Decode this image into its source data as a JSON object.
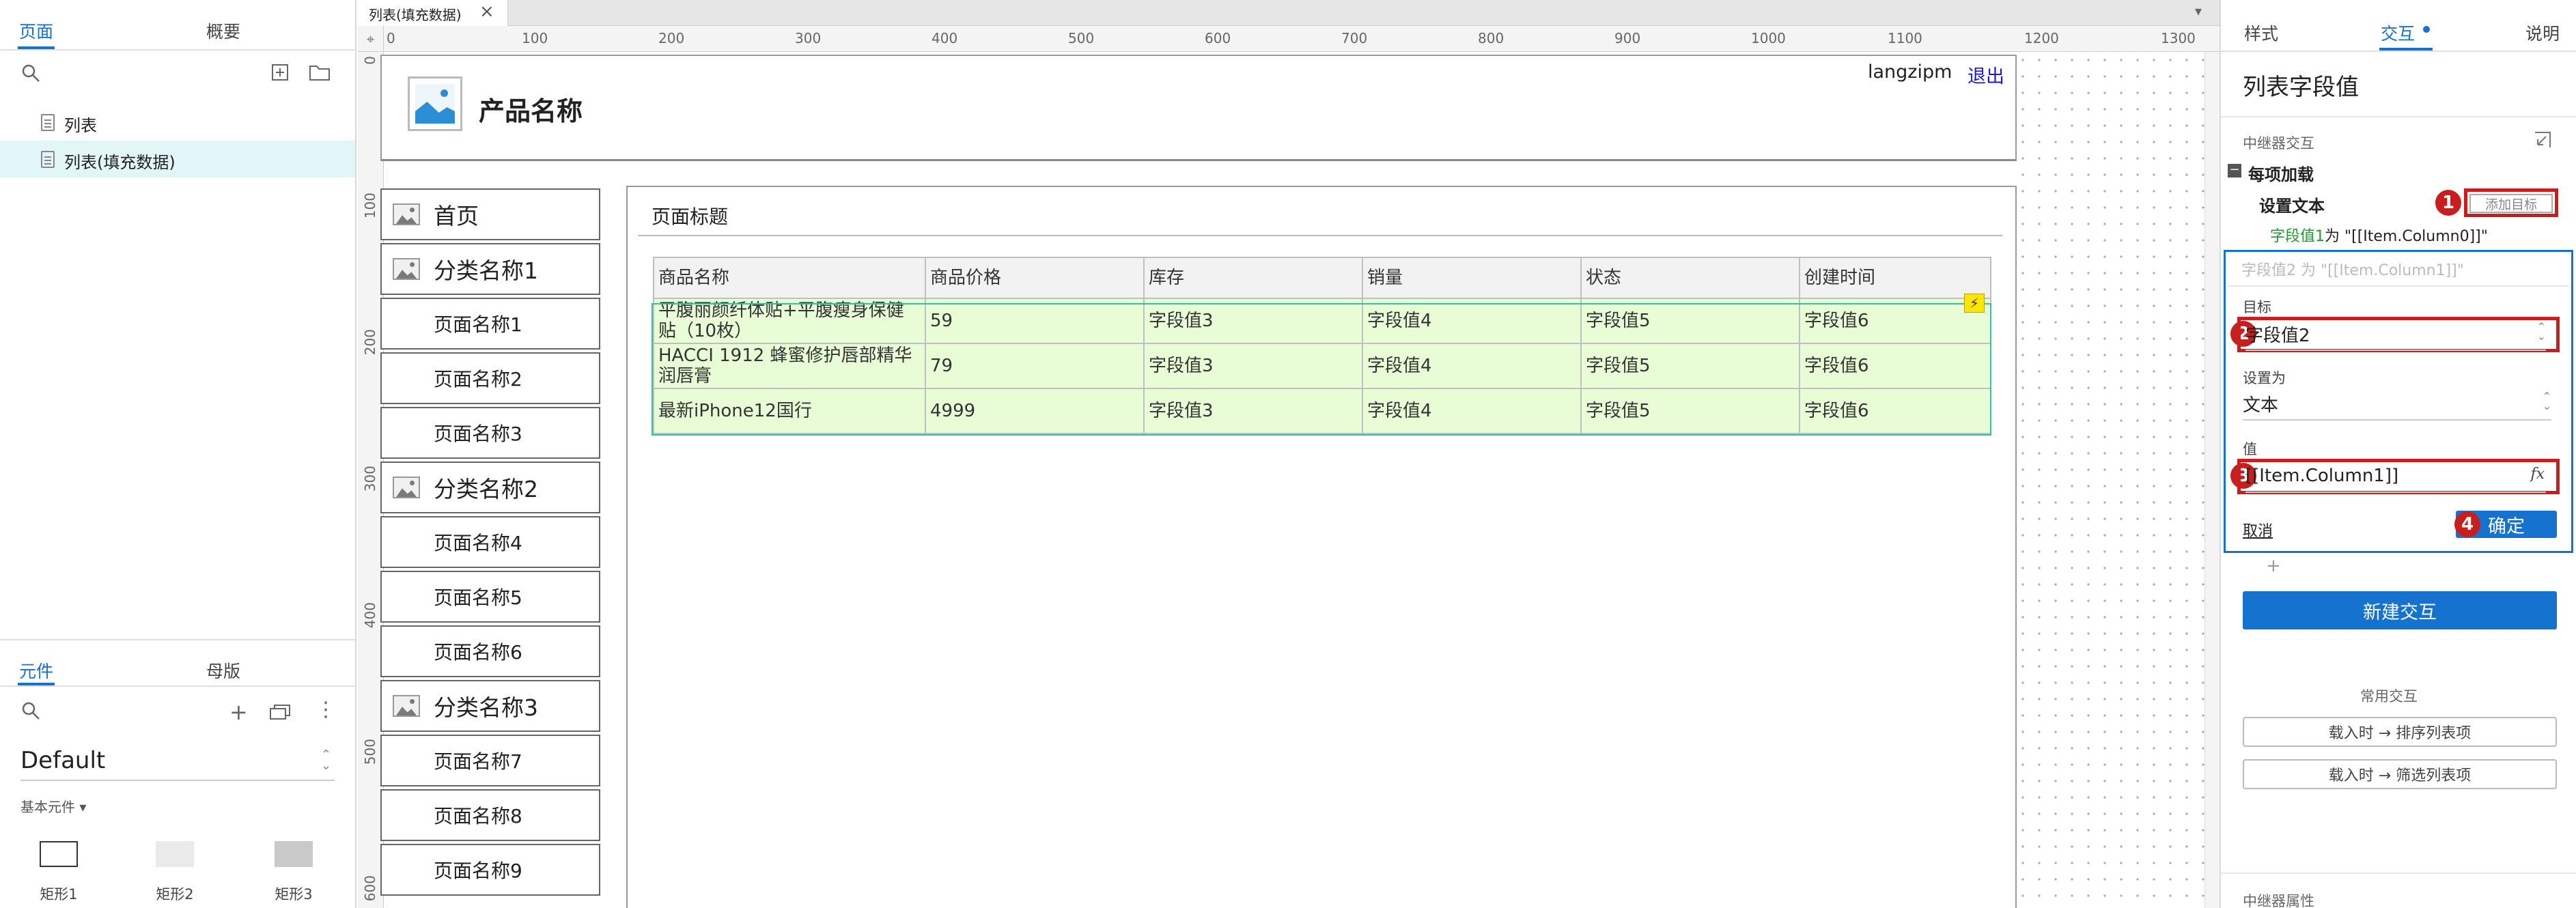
{
  "left_panel": {
    "tabs": [
      {
        "label": "页面"
      },
      {
        "label": "概要"
      }
    ],
    "pages": [
      {
        "label": "列表"
      },
      {
        "label": "列表(填充数据)"
      }
    ],
    "bottom_tabs": [
      {
        "label": "元件"
      },
      {
        "label": "母版"
      }
    ],
    "library": "Default",
    "category": "基本元件 ▾",
    "widgets": [
      {
        "label": "矩形1"
      },
      {
        "label": "矩形2"
      },
      {
        "label": "矩形3"
      }
    ]
  },
  "canvas": {
    "doc_tab": "列表(填充数据)",
    "ruler_h": [
      "0",
      "100",
      "200",
      "300",
      "400",
      "500",
      "600",
      "700",
      "800",
      "900",
      "1000",
      "1100",
      "1200",
      "1300"
    ],
    "ruler_v": [
      "0",
      "100",
      "200",
      "300",
      "400",
      "500",
      "600"
    ],
    "header": {
      "product_name": "产品名称",
      "user": "langzipm",
      "logout": "退出"
    },
    "nav": [
      {
        "label": "首页",
        "kind": "category"
      },
      {
        "label": "分类名称1",
        "kind": "category"
      },
      {
        "label": "页面名称1",
        "kind": "page"
      },
      {
        "label": "页面名称2",
        "kind": "page"
      },
      {
        "label": "页面名称3",
        "kind": "page"
      },
      {
        "label": "分类名称2",
        "kind": "category"
      },
      {
        "label": "页面名称4",
        "kind": "page"
      },
      {
        "label": "页面名称5",
        "kind": "page"
      },
      {
        "label": "页面名称6",
        "kind": "page"
      },
      {
        "label": "分类名称3",
        "kind": "category"
      },
      {
        "label": "页面名称7",
        "kind": "page"
      },
      {
        "label": "页面名称8",
        "kind": "page"
      },
      {
        "label": "页面名称9",
        "kind": "page"
      }
    ],
    "page_title": "页面标题",
    "table": {
      "columns": [
        "商品名称",
        "商品价格",
        "库存",
        "销量",
        "状态",
        "创建时间"
      ],
      "rows": [
        [
          "平腹丽颜纤体贴+平腹瘦身保健贴（10枚）",
          "59",
          "字段值3",
          "字段值4",
          "字段值5",
          "字段值6"
        ],
        [
          "HACCI 1912 蜂蜜修护唇部精华 润唇膏",
          "79",
          "字段值3",
          "字段值4",
          "字段值5",
          "字段值6"
        ],
        [
          "最新iPhone12国行",
          "4999",
          "字段值3",
          "字段值4",
          "字段值5",
          "字段值6"
        ]
      ]
    }
  },
  "right_panel": {
    "tabs": [
      {
        "label": "样式"
      },
      {
        "label": "交互"
      },
      {
        "label": "说明"
      }
    ],
    "title": "列表字段值",
    "section": "中继器交互",
    "event": "每项加载",
    "action": "设置文本",
    "add_target": "添加目标",
    "summary_name": "字段值1",
    "summary_rest": " 为 \"[[Item.Column0]]\"",
    "editing_summary": "字段值2 为 \"[[Item.Column1]]\"",
    "target_label": "目标",
    "target_value": "字段值2",
    "set_as_label": "设置为",
    "set_as_value": "文本",
    "value_label": "值",
    "value_input": "[[Item.Column1]]",
    "fx": "fx",
    "cancel": "取消",
    "confirm": "确定",
    "add_plus": "+",
    "new_interaction": "新建交互",
    "common_label": "常用交互",
    "common": [
      {
        "label": "载入时 → 排序列表项"
      },
      {
        "label": "载入时 → 筛选列表项"
      }
    ],
    "repeater_props": "中继器属性",
    "badges": [
      "1",
      "2",
      "3",
      "4"
    ]
  },
  "colors": {
    "accent": "#1572cf",
    "badge_red": "#c81e1e",
    "row_green": "#e8fcd6",
    "selected_page": "#e2f5f7"
  }
}
